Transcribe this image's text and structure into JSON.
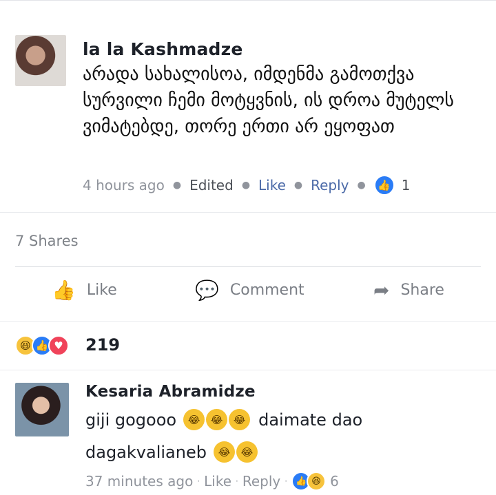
{
  "comment1": {
    "author": "la la Kashmadze",
    "text": "არადა სახალისოა, იმდენმა გამოთქვა სურვილი ჩემი მოტყვნის, ის დროა მუტელს ვიმატებდე, თორე ერთი არ ეყოფათ",
    "time": "4 hours ago",
    "edited": "Edited",
    "like": "Like",
    "reply": "Reply",
    "reaction_count": "1"
  },
  "post": {
    "shares": "7 Shares",
    "actions": {
      "like": "Like",
      "comment": "Comment",
      "share": "Share"
    },
    "reaction_count": "219"
  },
  "comment2": {
    "author": "Kesaria Abramidze",
    "line1_a": "giji gogooo",
    "line1_b": "daimate dao",
    "line2": "dagakvalianeb",
    "time": "37 minutes ago",
    "like": "Like",
    "reply": "Reply",
    "reaction_count": "6"
  },
  "colors": {
    "link": "#4b6aa8",
    "like_blue": "#2a7cf6",
    "haha_yellow": "#f7c33c",
    "love_red": "#f0435a",
    "muted": "#90949c"
  },
  "icons": [
    "like-thumb-icon",
    "comment-bubble-icon",
    "share-arrow-icon",
    "haha-emoji-icon",
    "love-heart-icon",
    "laughing-tears-emoji-icon"
  ]
}
